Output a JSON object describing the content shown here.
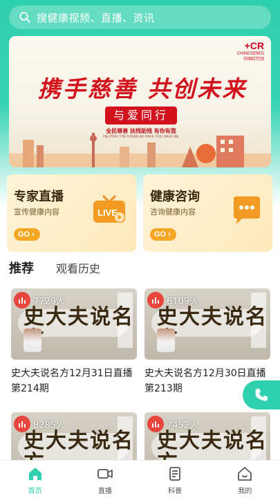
{
  "search": {
    "placeholder": "搜健康视频、直播、资讯"
  },
  "banner": {
    "slogan": "携手慈善 共创未来",
    "tag": "与爱同行",
    "sub1": "全民慈善 扶残助残 有你有我",
    "sub2": "HELPING THE DISABLED HAVE YOU HAVE ME",
    "cr_big": "+CR",
    "cr_small1": "CHINESERED",
    "cr_small2": "中国红行动"
  },
  "cards": [
    {
      "title": "专家直播",
      "desc": "宣传健康内容",
      "go": "GO",
      "icon": "live-tv-icon"
    },
    {
      "title": "健康咨询",
      "desc": "咨询健康内容",
      "go": "GO",
      "icon": "chat-bubble-icon"
    }
  ],
  "tabs": {
    "active": "推荐",
    "inactive": "观看历史"
  },
  "thumb_text": "史大夫说名方",
  "videos": [
    {
      "viewers": "7729人",
      "title": "史大夫说名方12月31日直播第214期"
    },
    {
      "viewers": "6109人",
      "title": "史大夫说名方12月30日直播第213期"
    },
    {
      "viewers": "8285人",
      "title": ""
    },
    {
      "viewers": "7452人",
      "title": ""
    }
  ],
  "nav": [
    {
      "label": "首页",
      "icon": "home-icon",
      "active": true
    },
    {
      "label": "直播",
      "icon": "video-camera-icon",
      "active": false
    },
    {
      "label": "科普",
      "icon": "document-icon",
      "active": false
    },
    {
      "label": "我的",
      "icon": "profile-house-icon",
      "active": false
    }
  ],
  "colors": {
    "accent": "#2fd0ad",
    "card_bg": "#fdebbf",
    "go_button": "#f5a623",
    "live_badge": "#e8453c",
    "slogan": "#d2121d"
  }
}
